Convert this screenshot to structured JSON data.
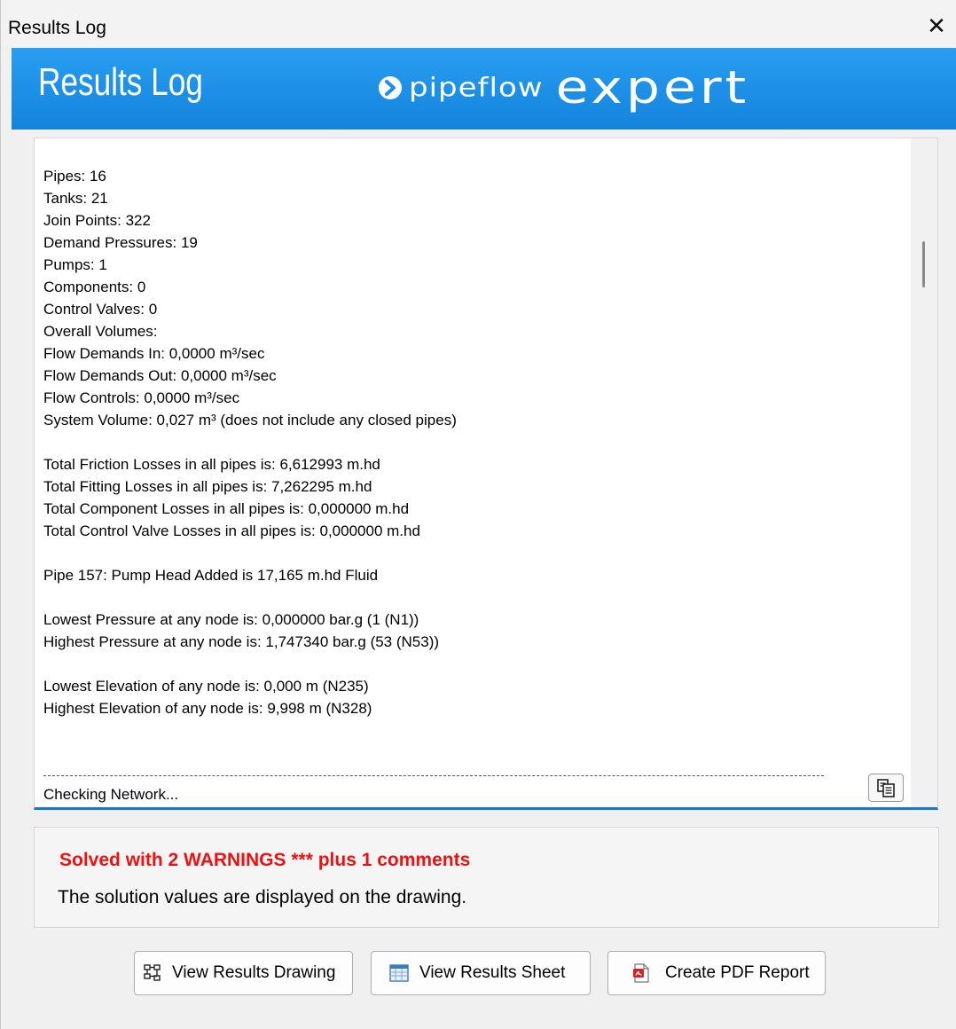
{
  "window": {
    "title": "Results Log",
    "close_glyph": "✕"
  },
  "banner": {
    "title": "Results Log",
    "brand_part1": "pipeflow",
    "brand_part2": "expert",
    "brand_arrow_icon": "chevron-right-circle-icon"
  },
  "log": {
    "lines": [
      "Pipes: 16",
      "Tanks: 21",
      "Join Points: 322",
      "Demand Pressures: 19",
      "Pumps: 1",
      "Components: 0",
      "Control Valves: 0",
      "Overall Volumes:",
      "Flow Demands In: 0,0000 m³/sec",
      "Flow Demands Out: 0,0000 m³/sec",
      "Flow Controls: 0,0000 m³/sec",
      "System Volume: 0,027 m³ (does not include any closed pipes)",
      "",
      "Total Friction Losses in all pipes is: 6,612993 m.hd",
      "Total Fitting Losses in all pipes is: 7,262295 m.hd",
      "Total Component Losses in all pipes is: 0,000000 m.hd",
      "Total Control Valve Losses in all pipes is: 0,000000 m.hd",
      "",
      "Pipe 157: Pump Head Added is 17,165 m.hd Fluid",
      "",
      "Lowest Pressure at any node is: 0,000000 bar.g (1 (N1))",
      "Highest Pressure at any node is: 1,747340 bar.g (53 (N53))",
      "",
      "Lowest Elevation of any node is: 0,000 m (N235)",
      "Highest Elevation of any node is: 9,998 m (N328)"
    ],
    "status_text": "Checking Network...",
    "copy_icon": "copy-icon"
  },
  "status": {
    "headline": "Solved with 2 WARNINGS *** plus 1 comments",
    "message": "The solution values are displayed on the drawing.",
    "headline_color": "#ee1111"
  },
  "buttons": {
    "view_drawing": "View Results Drawing",
    "view_sheet": "View Results Sheet",
    "create_pdf": "Create PDF Report"
  },
  "colors": {
    "banner_blue": "#1c8fe6",
    "accent_underline": "#1778c9"
  }
}
